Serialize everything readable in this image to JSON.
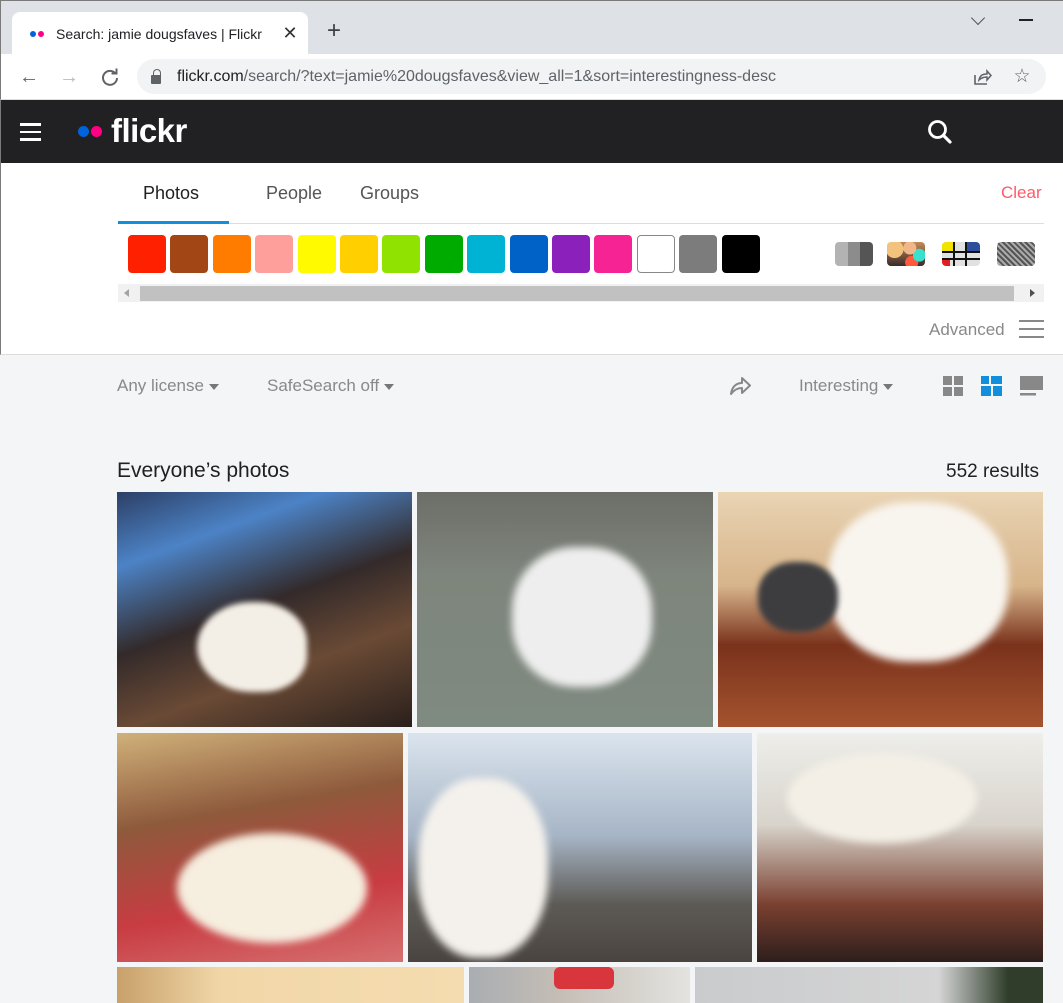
{
  "browser": {
    "tab_title": "Search: jamie dougsfaves | Flickr",
    "url_host": "flickr.com",
    "url_path": "/search/?text=jamie%20dougsfaves&view_all=1&sort=interestingness-desc",
    "favicon_colors": [
      "#0063dc",
      "#ff0084"
    ]
  },
  "header": {
    "logo_text": "flickr",
    "logo_colors": [
      "#0063dc",
      "#ff0084"
    ]
  },
  "search_tabs": [
    {
      "label": "Photos",
      "active": true
    },
    {
      "label": "People",
      "active": false
    },
    {
      "label": "Groups",
      "active": false
    }
  ],
  "clear_label": "Clear",
  "color_swatches": [
    {
      "name": "red",
      "color": "#ff2000"
    },
    {
      "name": "dark-orange",
      "color": "#a24615"
    },
    {
      "name": "orange",
      "color": "#ff7c00"
    },
    {
      "name": "pale-pink",
      "color": "#ff9f9c"
    },
    {
      "name": "lemon-yellow",
      "color": "#fffa00"
    },
    {
      "name": "school-bus-yellow",
      "color": "#ffcf00"
    },
    {
      "name": "green",
      "color": "#90e200"
    },
    {
      "name": "dark-lime-green",
      "color": "#00ab00"
    },
    {
      "name": "cyan",
      "color": "#00b2d4"
    },
    {
      "name": "blue",
      "color": "#0062c6"
    },
    {
      "name": "violet",
      "color": "#8c20ba"
    },
    {
      "name": "pink",
      "color": "#f52394"
    },
    {
      "name": "white",
      "color": "#ffffff"
    },
    {
      "name": "gray",
      "color": "#7c7c7c"
    },
    {
      "name": "black",
      "color": "#000000"
    }
  ],
  "style_filters": [
    "black-and-white",
    "shallow-depth-of-field",
    "minimalist",
    "patterns"
  ],
  "advanced_label": "Advanced",
  "filters": {
    "license": "Any license",
    "safesearch": "SafeSearch off",
    "sort": "Interesting"
  },
  "view_modes": [
    {
      "name": "grid",
      "active": false
    },
    {
      "name": "justified",
      "active": true
    },
    {
      "name": "single",
      "active": false
    }
  ],
  "section_title": "Everyone’s photos",
  "results_count": "552 results",
  "photos": [
    {
      "subject": "white dog on bridge at dusk"
    },
    {
      "subject": "white puppy running on pavement"
    },
    {
      "subject": "cat and white dog on table"
    },
    {
      "subject": "puppy sleeping on red blanket"
    },
    {
      "subject": "puppy with city skyline"
    },
    {
      "subject": "white dog jumping by door"
    },
    {
      "subject": "photo"
    },
    {
      "subject": "white dog by red chair"
    },
    {
      "subject": "outdoor landscape"
    }
  ]
}
